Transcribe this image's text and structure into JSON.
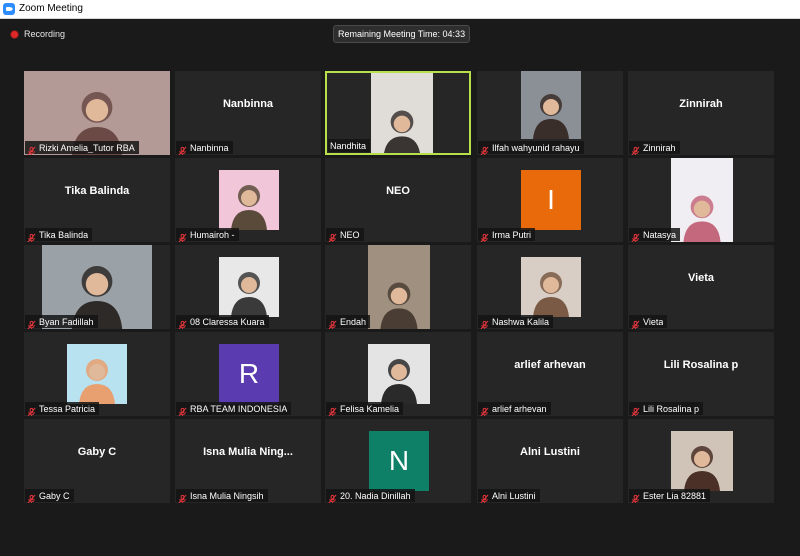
{
  "window": {
    "title": "Zoom Meeting",
    "icon": "zoom-app-icon"
  },
  "recording": {
    "label": "Recording",
    "dot_color": "#e02828"
  },
  "timer": {
    "text": "Remaining Meeting Time: 04:33"
  },
  "accent": {
    "active_speaker": "#b8e04a",
    "muted_icon": "#e0353b"
  },
  "tiles": [
    {
      "name": "Rizki Amelia_Tutor RBA",
      "display": "video"
    },
    {
      "name": "Nanbinna",
      "display": "name",
      "big_name": "Nanbinna"
    },
    {
      "name": "Nandhita",
      "display": "video",
      "active": true
    },
    {
      "name": "Ilfah wahyunid rahayu",
      "display": "photo"
    },
    {
      "name": "Zinnirah",
      "display": "name",
      "big_name": "Zinnirah"
    },
    {
      "name": "Tika Balinda",
      "display": "name",
      "big_name": "Tika Balinda"
    },
    {
      "name": "Humairoh -",
      "display": "illustration"
    },
    {
      "name": "NEO",
      "display": "name",
      "big_name": "NEO"
    },
    {
      "name": "Irma Putri",
      "display": "letter",
      "letter": "I",
      "color": "#e86a0a"
    },
    {
      "name": "Natasya",
      "display": "photo"
    },
    {
      "name": "Byan Fadillah",
      "display": "video"
    },
    {
      "name": "08 Claressa Kuara",
      "display": "photo"
    },
    {
      "name": "Endah",
      "display": "video"
    },
    {
      "name": "Nashwa Kalila",
      "display": "photo"
    },
    {
      "name": "Vieta",
      "display": "name",
      "big_name": "Vieta"
    },
    {
      "name": "Tessa Patricia",
      "display": "illustration"
    },
    {
      "name": "RBA TEAM INDONESIA",
      "display": "letter",
      "letter": "R",
      "color": "#5a3bb0"
    },
    {
      "name": "Felisa Kamelia",
      "display": "photo"
    },
    {
      "name": "arlief arhevan",
      "display": "name",
      "big_name": "arlief arhevan"
    },
    {
      "name": "Lili Rosalina p",
      "display": "name",
      "big_name": "Lili Rosalina p"
    },
    {
      "name": "Gaby C",
      "display": "name",
      "big_name": "Gaby C"
    },
    {
      "name": "Isna Mulia Ningsih",
      "display": "name",
      "big_name": "Isna  Mulia  Ning..."
    },
    {
      "name": "20. Nadia Dinillah",
      "display": "letter",
      "letter": "N",
      "color": "#0f8068"
    },
    {
      "name": "Alni Lustini",
      "display": "name",
      "big_name": "Alni Lustini"
    },
    {
      "name": "Ester Lia 82881",
      "display": "photo"
    }
  ]
}
